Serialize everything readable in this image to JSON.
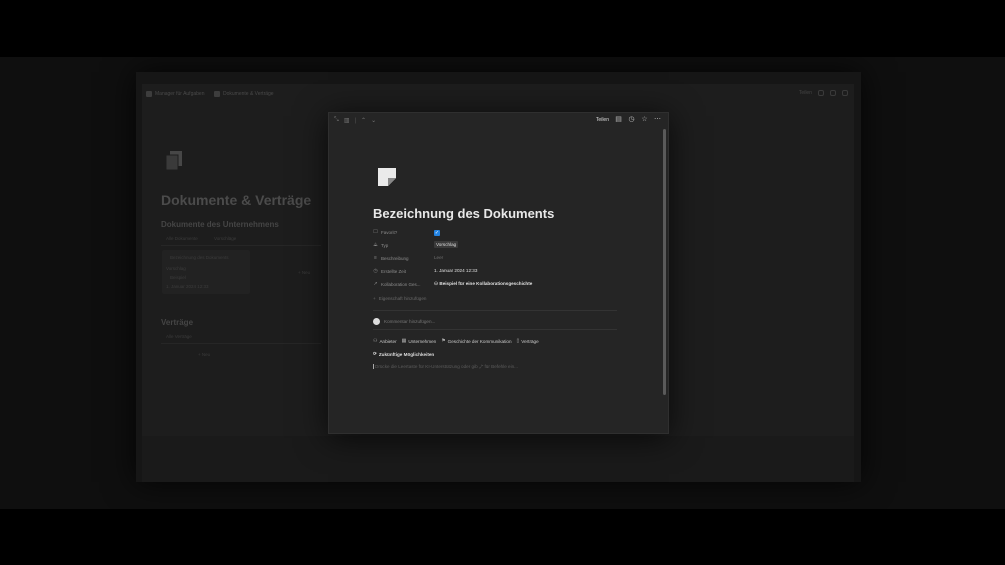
{
  "breadcrumb": {
    "item1": "Manager für Aufgaben",
    "item2": "Dokumente & Verträge"
  },
  "top_right": {
    "share": "Teilen"
  },
  "background_page": {
    "title": "Dokumente & Verträge",
    "section1": "Dokumente des Unternehmens",
    "view_all": "Alle Dokumente",
    "view_sort": "Vorschläge",
    "card_title": "Bezeichnung des Dokuments",
    "card_tag": "Vorschlag",
    "card_sub": "Beispiel",
    "card_date": "1. Januar 2024 12:33",
    "section2": "Verträge",
    "view_contracts": "Alle Verträge",
    "new": "+ Neu"
  },
  "modal": {
    "share_label": "Teilen",
    "title": "Bezeichnung des Dokuments",
    "properties": {
      "favorite_label": "Favorit?",
      "type_label": "Typ",
      "type_value": "Vorschlag",
      "description_label": "Beschreibung",
      "description_value": "Leer",
      "created_label": "Erstellte Zeit",
      "created_value": "1. Januar 2024 12:33",
      "collab_label": "Kollaboration Ges...",
      "collab_value": "Beispiel für eine Kollaborationsgeschichte"
    },
    "add_property": "Eigenschaft hinzufügen",
    "comment_placeholder": "Kommentar hinzufügen...",
    "links": {
      "anbieter": "Anbieter",
      "unternehmen": "Unternehmen",
      "geschichte": "Geschichte der Kommunikation",
      "vertraege": "Verträge"
    },
    "future": "Zukünftige Möglichkeiten",
    "editor_placeholder": "Drücke die Leertaste für KI-Unterstützung oder gib „/“ für Befehle ein..."
  }
}
